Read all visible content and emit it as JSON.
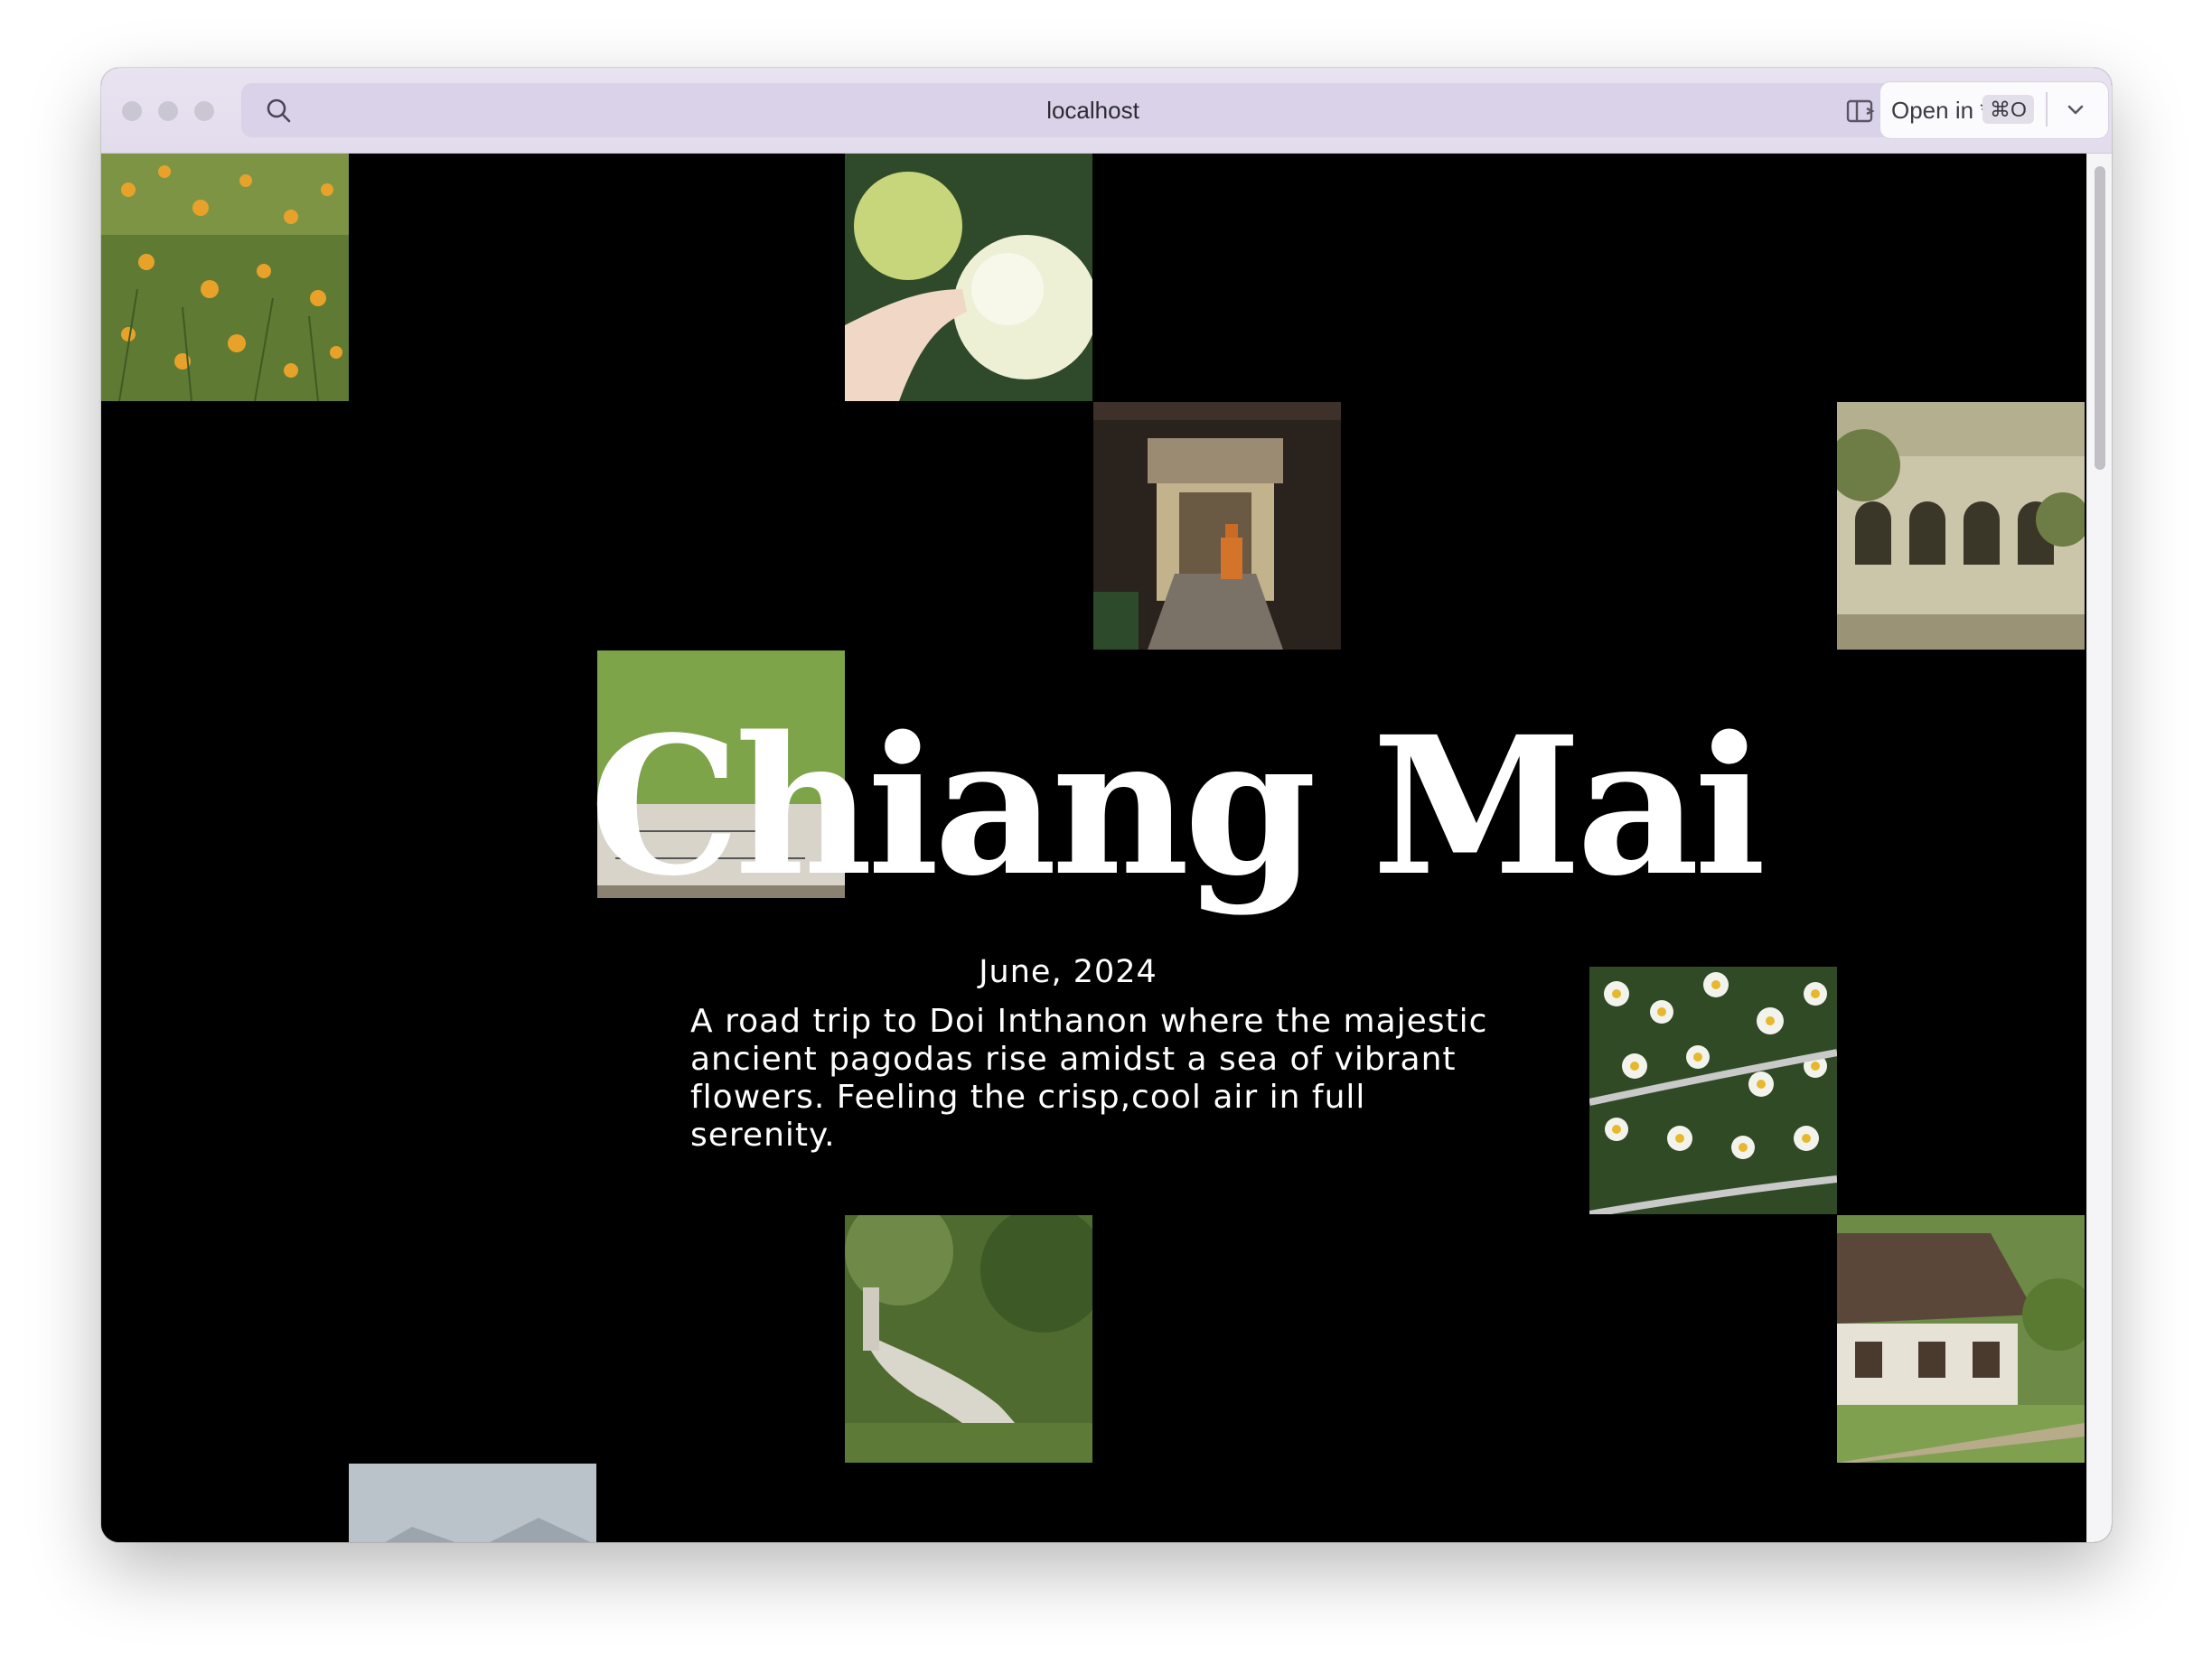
{
  "browser": {
    "url": "localhost",
    "open_in_label": "Open in *",
    "open_in_shortcut": "⌘O"
  },
  "hero": {
    "title": "Chiang Mai",
    "date": "June, 2024",
    "description": "A road trip to Doi Inthanon where the majestic ancient pagodas rise amidst a sea of vibrant flowers. Feeling the crisp,cool air in full serenity."
  },
  "photos": [
    {
      "name": "photo-orange-wildflowers"
    },
    {
      "name": "photo-hydrangea-hand"
    },
    {
      "name": "photo-monk-temple-gate"
    },
    {
      "name": "photo-temple-arches"
    },
    {
      "name": "photo-grass-stone-sign"
    },
    {
      "name": "photo-daisies"
    },
    {
      "name": "photo-naga-statue"
    },
    {
      "name": "photo-wooden-house"
    },
    {
      "name": "photo-misty-mountains"
    }
  ],
  "colors": {
    "page_background": "#000000",
    "text": "#ffffff",
    "chrome": "#e6e0ee"
  }
}
